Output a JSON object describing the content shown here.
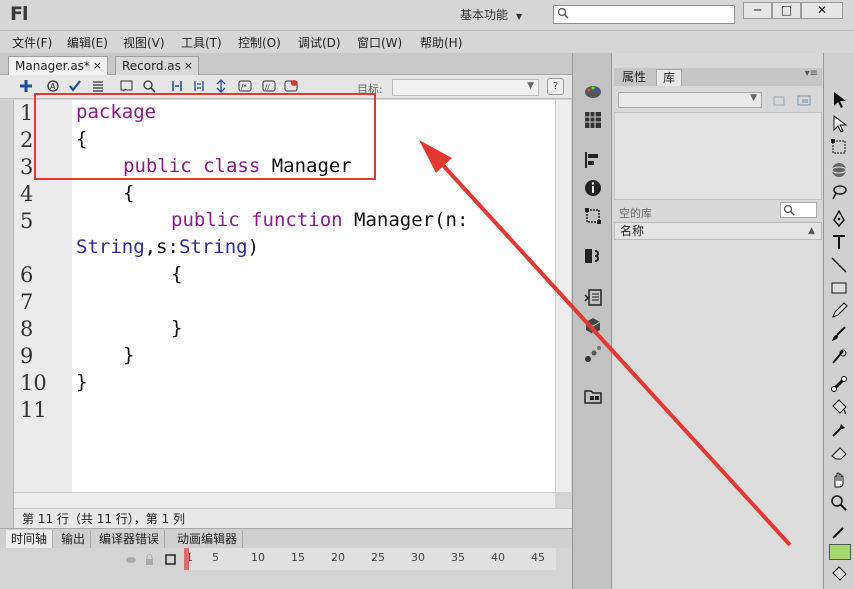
{
  "app": {
    "logo": "Fl",
    "workspace": "基本功能",
    "search_placeholder": ""
  },
  "window_controls": {
    "minimize": "─",
    "maximize": "□",
    "close": "✕"
  },
  "menu": [
    "文件(F)",
    "编辑(E)",
    "视图(V)",
    "工具(T)",
    "控制(O)",
    "调试(D)",
    "窗口(W)",
    "帮助(H)"
  ],
  "doc_tabs": [
    {
      "label": "Manager.as*",
      "close": "×",
      "active": true
    },
    {
      "label": "Record.as",
      "close": "×",
      "active": false
    }
  ],
  "editor_toolbar": {
    "target_label": "目标:",
    "help": "?"
  },
  "code": {
    "line_numbers": [
      "1",
      "2",
      "3",
      "4",
      "5",
      "6",
      "7",
      "8",
      "9",
      "10",
      "11"
    ],
    "lines": {
      "l1": "package",
      "l2": "{",
      "l3_kw": "public class",
      "l3_name": " Manager",
      "l4": "{",
      "l5_kw": "public function",
      "l5_rest": " Manager(n:",
      "l5b_type1": "String",
      "l5b_mid": ",s:",
      "l5b_type2": "String",
      "l5b_end": ")",
      "l6": "{",
      "l8": "}",
      "l9": "}",
      "l10": "}"
    }
  },
  "status": "第 11 行（共 11 行），第 1 列",
  "bottom_tabs": [
    "时间轴",
    "输出",
    "编译器错误",
    "动画编辑器"
  ],
  "ruler": [
    "1",
    "5",
    "10",
    "15",
    "20",
    "25",
    "30",
    "35",
    "40",
    "45"
  ],
  "right_panel": {
    "tabs": [
      "属性",
      "库"
    ],
    "empty_library": "空的库",
    "column_name": "名称"
  },
  "colors": {
    "keyword": "#8b1a8b",
    "type": "#2b2b9a",
    "annotation": "#e23a33",
    "fill_swatch": "#a6d86e"
  }
}
